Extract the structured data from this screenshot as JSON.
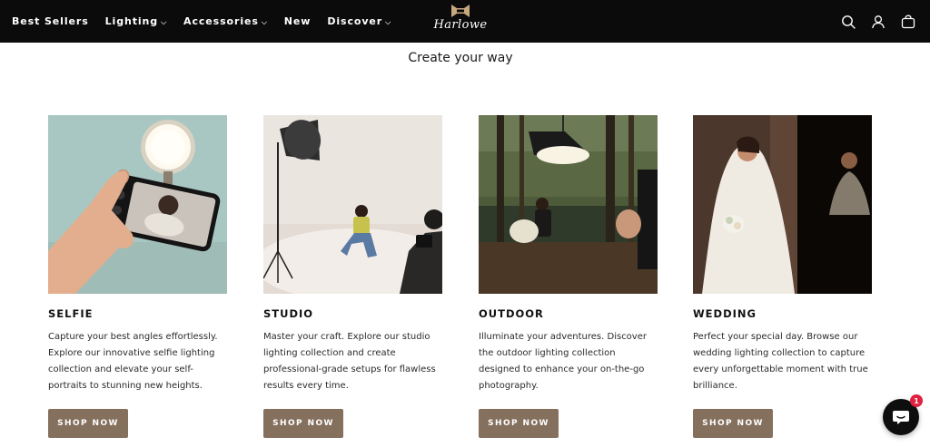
{
  "nav": {
    "links": [
      {
        "label": "Best Sellers",
        "dropdown": false
      },
      {
        "label": "Lighting",
        "dropdown": true
      },
      {
        "label": "Accessories",
        "dropdown": true
      },
      {
        "label": "New",
        "dropdown": false
      },
      {
        "label": "Discover",
        "dropdown": true
      }
    ],
    "logo_text": "Harlowe",
    "icons": [
      "search-icon",
      "account-icon",
      "cart-icon"
    ]
  },
  "main": {
    "headline": "Create your way",
    "cards": [
      {
        "title": "SELFIE",
        "description": "Capture your best angles effortlessly. Explore our innovative selfie lighting collection and elevate your self-portraits to stunning new heights.",
        "button": "SHOP NOW"
      },
      {
        "title": "STUDIO",
        "description": "Master your craft. Explore our studio lighting collection and create professional-grade setups for flawless results every time.",
        "button": "SHOP NOW"
      },
      {
        "title": "OUTDOOR",
        "description": "Illuminate your adventures. Discover the outdoor lighting collection designed to enhance your on-the-go photography.",
        "button": "SHOP NOW"
      },
      {
        "title": "WEDDING",
        "description": "Perfect your special day. Browse our wedding lighting collection to capture every unforgettable moment with true brilliance.",
        "button": "SHOP NOW"
      }
    ]
  },
  "chat": {
    "badge_count": "1"
  },
  "colors": {
    "nav_bg": "#0b0b0b",
    "button_bg": "#85705e",
    "logo_gold": "#c8a97e",
    "badge": "#e0213f"
  }
}
